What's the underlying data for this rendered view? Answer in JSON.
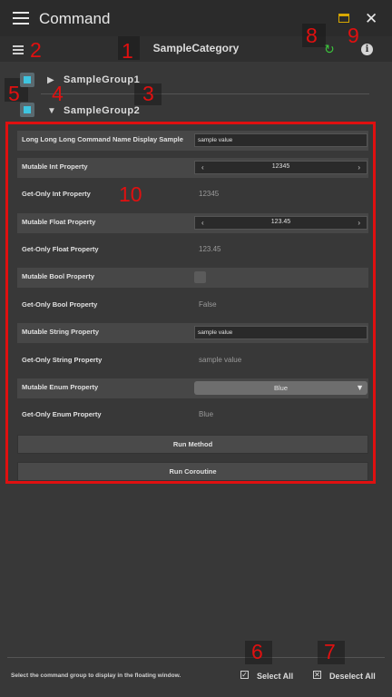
{
  "window": {
    "title": "Command",
    "close_glyph": "✕"
  },
  "toolbar": {
    "category": "SampleCategory",
    "refresh_glyph": "↻",
    "info_glyph": "i"
  },
  "groups": [
    {
      "label": "SampleGroup1",
      "arrow": "▶"
    },
    {
      "label": "SampleGroup2",
      "arrow": "▼"
    }
  ],
  "markers": [
    "1",
    "2",
    "3",
    "4",
    "5",
    "6",
    "7",
    "8",
    "9",
    "10"
  ],
  "properties": {
    "long_name": {
      "label": "Long Long Long Command Name Display Sample",
      "value": "sample value"
    },
    "mutable_int": {
      "label": "Mutable Int Property",
      "value": "12345"
    },
    "getonly_int": {
      "label": "Get-Only Int Property",
      "value": "12345"
    },
    "mutable_float": {
      "label": "Mutable Float Property",
      "value": "123.45"
    },
    "getonly_float": {
      "label": "Get-Only Float Property",
      "value": "123.45"
    },
    "mutable_bool": {
      "label": "Mutable Bool Property"
    },
    "getonly_bool": {
      "label": "Get-Only Bool Property",
      "value": "False"
    },
    "mutable_string": {
      "label": "Mutable String Property",
      "value": "sample value"
    },
    "getonly_string": {
      "label": "Get-Only String Property",
      "value": "sample value"
    },
    "mutable_enum": {
      "label": "Mutable Enum Property",
      "value": "Blue",
      "caret": "▼"
    },
    "getonly_enum": {
      "label": "Get-Only Enum Property",
      "value": "Blue"
    }
  },
  "stepper": {
    "left": "‹",
    "right": "›"
  },
  "buttons": {
    "run_method": "Run Method",
    "run_coroutine": "Run Coroutine"
  },
  "footer": {
    "hint": "Select the command group to display in the floating window.",
    "select_all": "Select All",
    "deselect_all": "Deselect All",
    "select_glyph": "✓",
    "deselect_glyph": "✕"
  },
  "colors": {
    "marker": "#e01010",
    "accent": "#3ec5e0",
    "refresh": "#3cc43c",
    "window_icon": "#d8a800"
  }
}
